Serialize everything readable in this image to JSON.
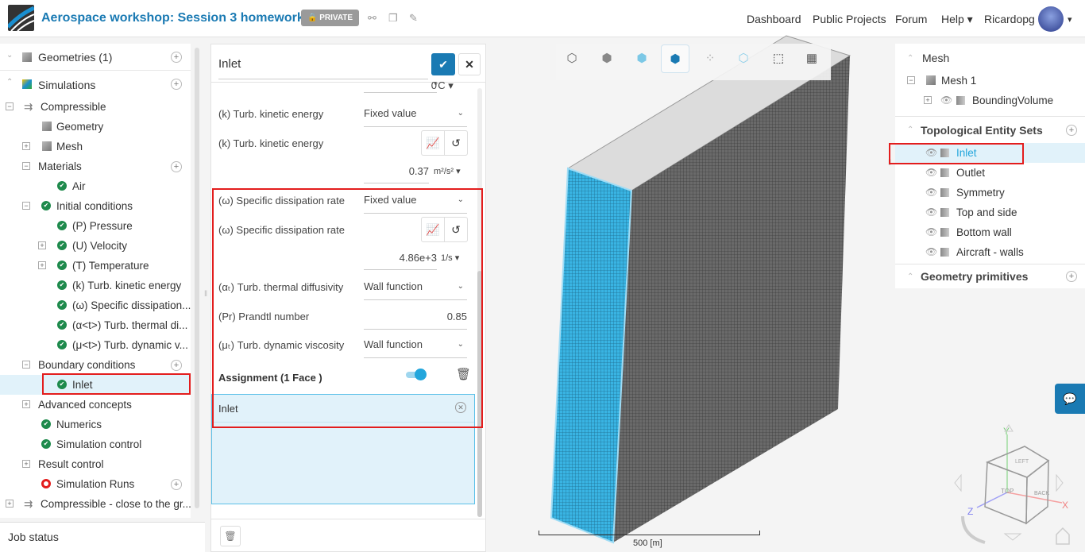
{
  "header": {
    "title": "Aerospace workshop: Session 3 homework",
    "badge": "PRIVATE",
    "nav": [
      "Dashboard",
      "Public Projects",
      "Forum",
      "Help"
    ],
    "user": "Ricardopg"
  },
  "tree": {
    "geometries": "Geometries (1)",
    "simulations": "Simulations",
    "items": [
      "Compressible",
      "Geometry",
      "Mesh",
      "Materials",
      "Air",
      "Initial conditions",
      "(P) Pressure",
      "(U) Velocity",
      "(T) Temperature",
      "(k) Turb. kinetic energy",
      "(ω) Specific dissipation...",
      "(α<t>) Turb. thermal di...",
      "(μ<t>) Turb. dynamic v...",
      "Boundary conditions",
      "Inlet",
      "Advanced concepts",
      "Numerics",
      "Simulation control",
      "Result control",
      "Simulation Runs",
      "Compressible - close to the gr..."
    ]
  },
  "job_status": "Job status",
  "editor": {
    "name": "Inlet",
    "temp_value": "0",
    "temp_unit": "°C",
    "k_type_label": "(k) Turb. kinetic energy",
    "k_type": "Fixed value",
    "k_value_label": "(k) Turb. kinetic energy",
    "k_value": "0.37",
    "k_unit": "m²/s²",
    "w_type_label": "(ω) Specific dissipation rate",
    "w_type": "Fixed value",
    "w_value_label": "(ω) Specific dissipation rate",
    "w_value": "4.86e+3",
    "w_unit": "1/s",
    "alpha_label": "(αₜ) Turb. thermal diffusivity",
    "alpha_type": "Wall function",
    "pr_label": "(Pr) Prandtl number",
    "pr_value": "0.85",
    "mu_label": "(μₜ) Turb. dynamic viscosity",
    "mu_type": "Wall function",
    "assignment": "Assignment (1 Face )",
    "assigned": [
      "Inlet"
    ]
  },
  "viewer": {
    "scale_label": "500 [m]",
    "axes": {
      "x": "X",
      "y": "Y",
      "z": "Z"
    },
    "cube_faces": {
      "top": "TOP",
      "back": "BACK",
      "left": "LEFT"
    }
  },
  "right": {
    "mesh_section": "Mesh",
    "mesh_item": "Mesh 1",
    "bounding": "BoundingVolume",
    "tes_section": "Topological Entity Sets",
    "entities": [
      "Inlet",
      "Outlet",
      "Symmetry",
      "Top and side",
      "Bottom wall",
      "Aircraft - walls"
    ],
    "geom_prims": "Geometry primitives"
  },
  "colors": {
    "accent": "#1a7ab3",
    "selected": "#e1f2fa",
    "highlight": "#e31d1d",
    "mesh_face": "#39b4e3"
  }
}
